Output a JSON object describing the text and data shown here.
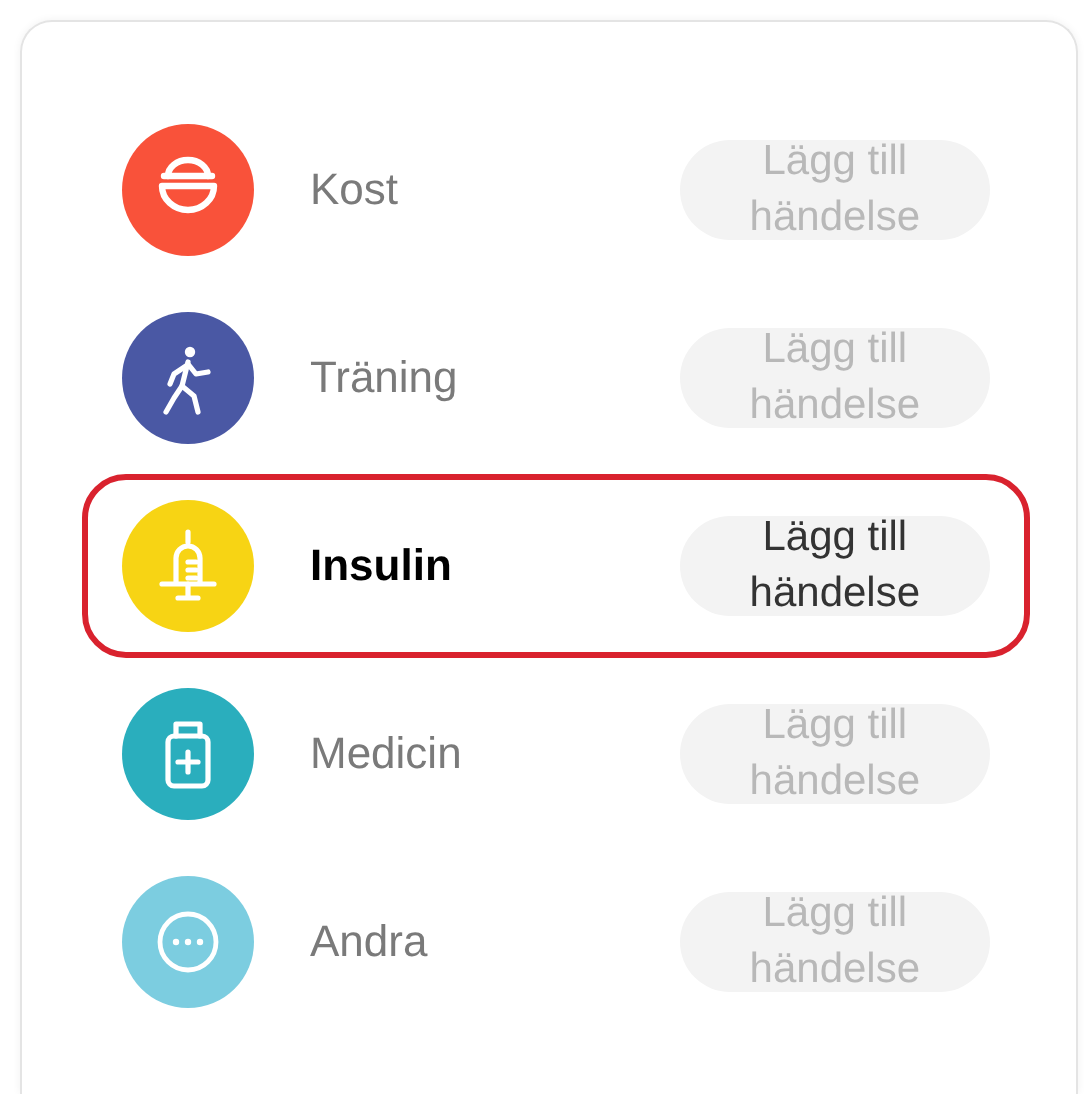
{
  "items": [
    {
      "kind": "bowl",
      "label": "Kost",
      "color": "#f9523a",
      "button": "Lägg till händelse",
      "selected": false
    },
    {
      "kind": "runner",
      "label": "Träning",
      "color": "#4a58a4",
      "button": "Lägg till händelse",
      "selected": false
    },
    {
      "kind": "syringe",
      "label": "Insulin",
      "color": "#f7d414",
      "button": "Lägg till händelse",
      "selected": true
    },
    {
      "kind": "medicine",
      "label": "Medicin",
      "color": "#2aaebd",
      "button": "Lägg till händelse",
      "selected": false
    },
    {
      "kind": "more",
      "label": "Andra",
      "color": "#7ccde0",
      "button": "Lägg till händelse",
      "selected": false
    }
  ]
}
